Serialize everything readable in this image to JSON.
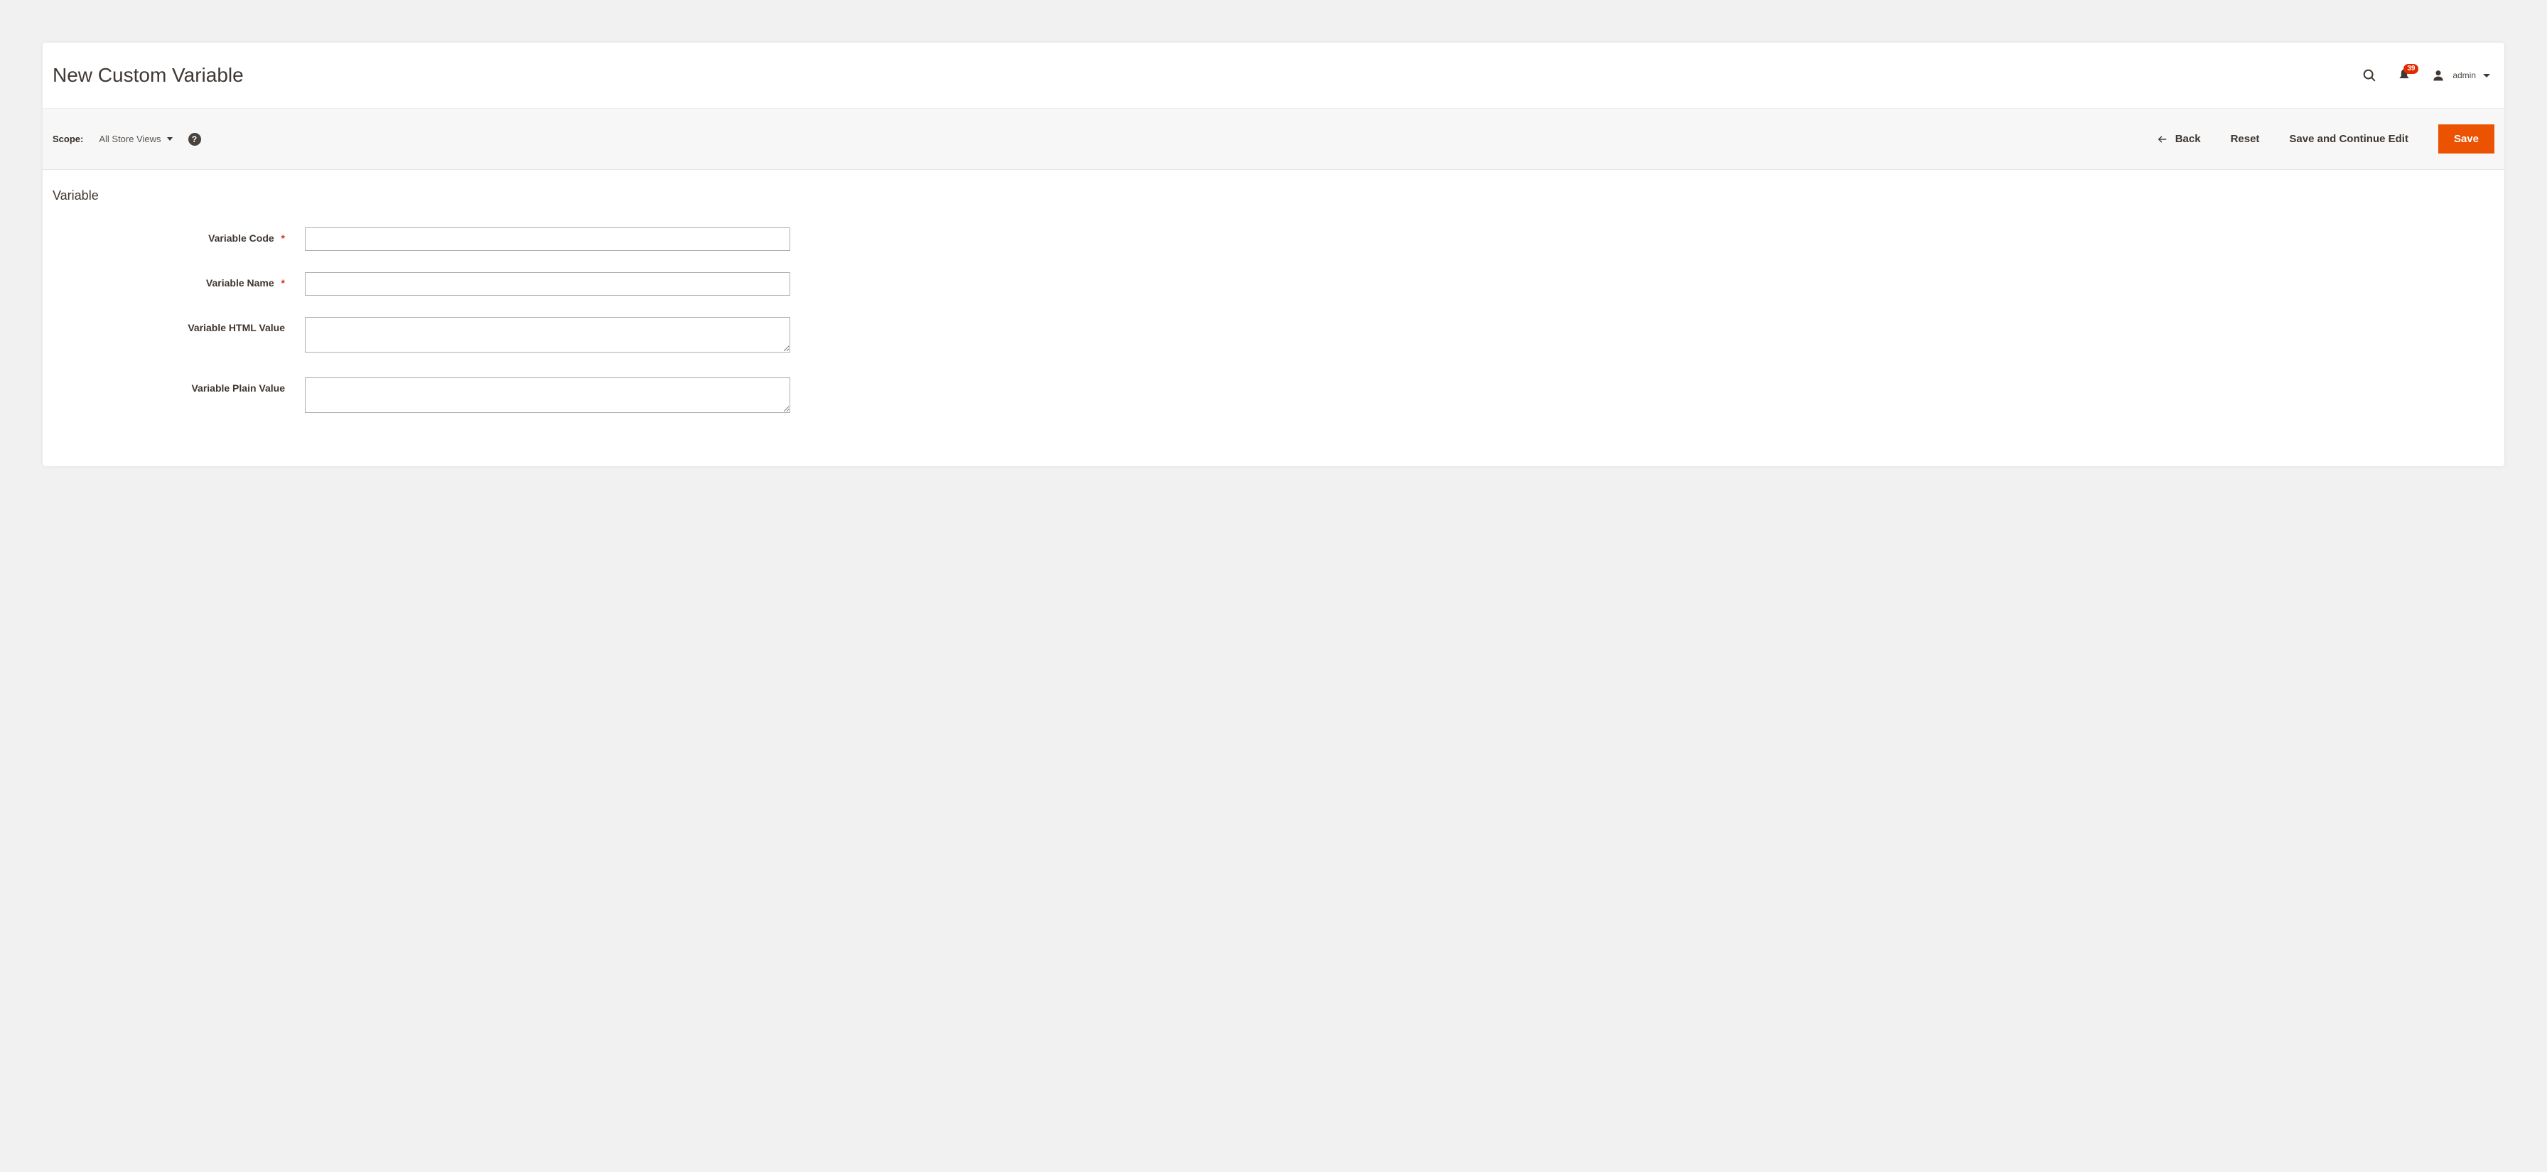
{
  "header": {
    "title": "New Custom Variable",
    "notifications_count": "39",
    "admin_name": "admin"
  },
  "action_bar": {
    "scope_label": "Scope:",
    "scope_value": "All Store Views",
    "help_tooltip": "?",
    "back_label": "Back",
    "reset_label": "Reset",
    "save_continue_label": "Save and Continue Edit",
    "save_label": "Save"
  },
  "form": {
    "section_title": "Variable",
    "fields": {
      "code": {
        "label": "Variable Code",
        "required": true,
        "value": ""
      },
      "name": {
        "label": "Variable Name",
        "required": true,
        "value": ""
      },
      "html_value": {
        "label": "Variable HTML Value",
        "required": false,
        "value": ""
      },
      "plain_value": {
        "label": "Variable Plain Value",
        "required": false,
        "value": ""
      }
    }
  }
}
